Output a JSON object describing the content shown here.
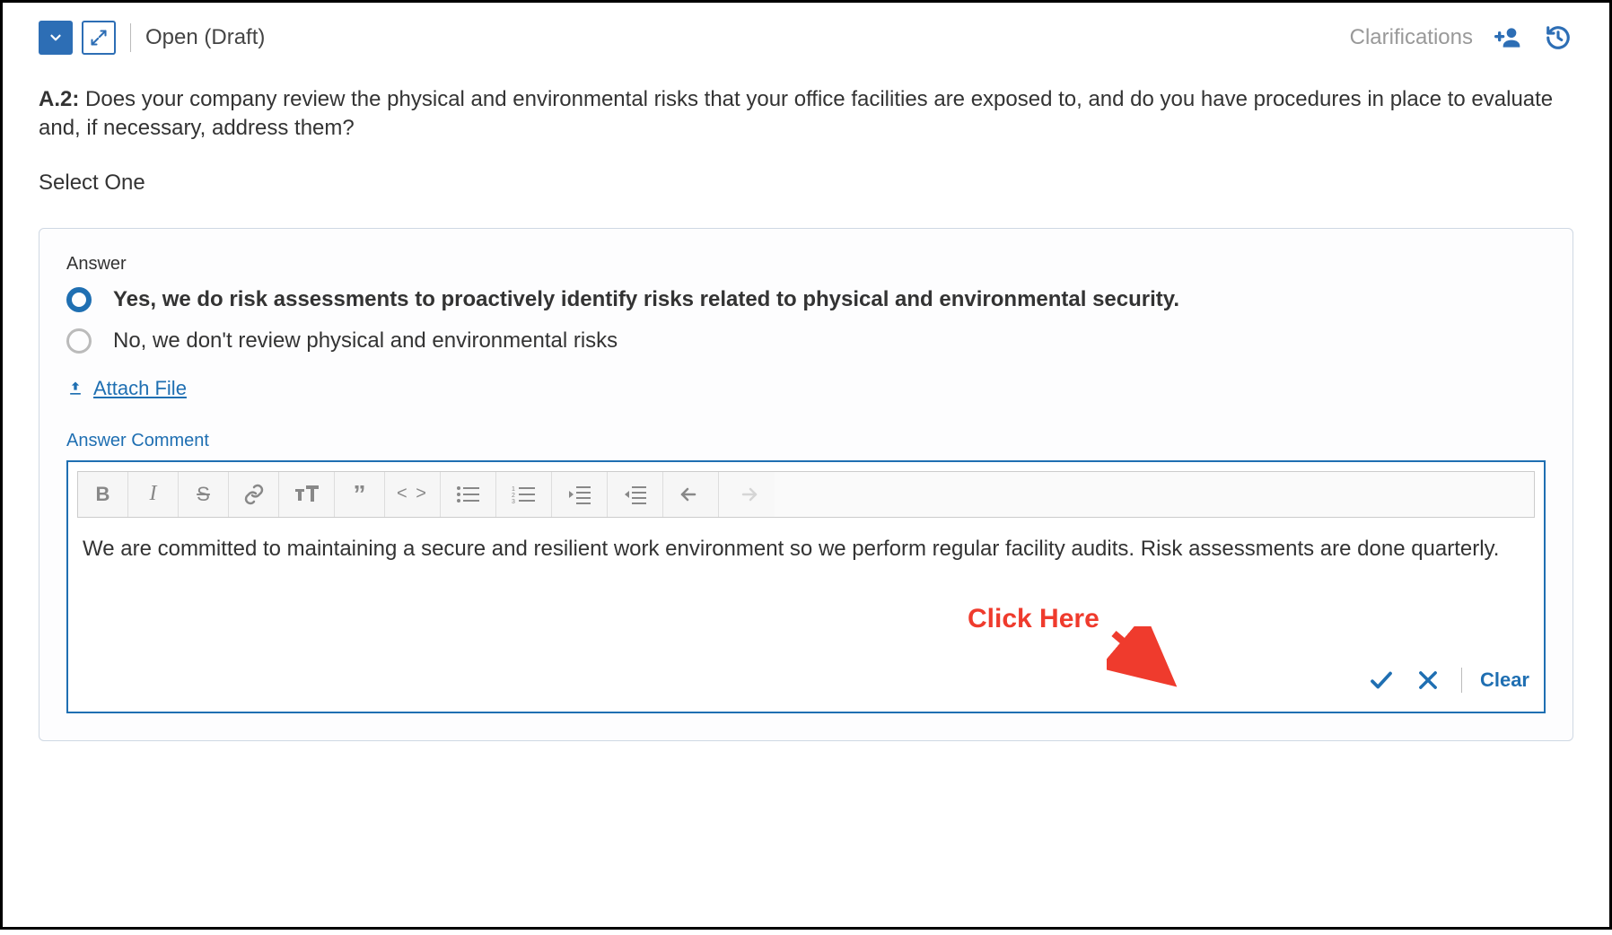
{
  "header": {
    "status_label": "Open (Draft)",
    "clarifications_label": "Clarifications"
  },
  "question": {
    "prefix": "A.2:",
    "text": "Does your company review the physical and environmental risks that your office facilities are exposed to, and do you have procedures in place to evaluate and, if necessary, address them?"
  },
  "select_one_label": "Select One",
  "answer": {
    "label": "Answer",
    "options": [
      {
        "label": "Yes, we do risk assessments to proactively identify risks related to physical and environmental security.",
        "selected": true
      },
      {
        "label": "No, we don't review physical and environmental risks",
        "selected": false
      }
    ],
    "attach_label": "Attach File",
    "comment_label": "Answer Comment",
    "comment_text": "We are committed to maintaining a secure and resilient work environment so we perform regular facility audits. Risk assessments are done quarterly.",
    "clear_label": "Clear"
  },
  "toolbar_icons": [
    "bold-icon",
    "italic-icon",
    "strikethrough-icon",
    "link-icon",
    "textsize-icon",
    "quote-icon",
    "code-icon",
    "bullet-list-icon",
    "number-list-icon",
    "outdent-icon",
    "indent-icon",
    "undo-icon",
    "redo-icon"
  ],
  "annotation": {
    "text": "Click Here"
  }
}
